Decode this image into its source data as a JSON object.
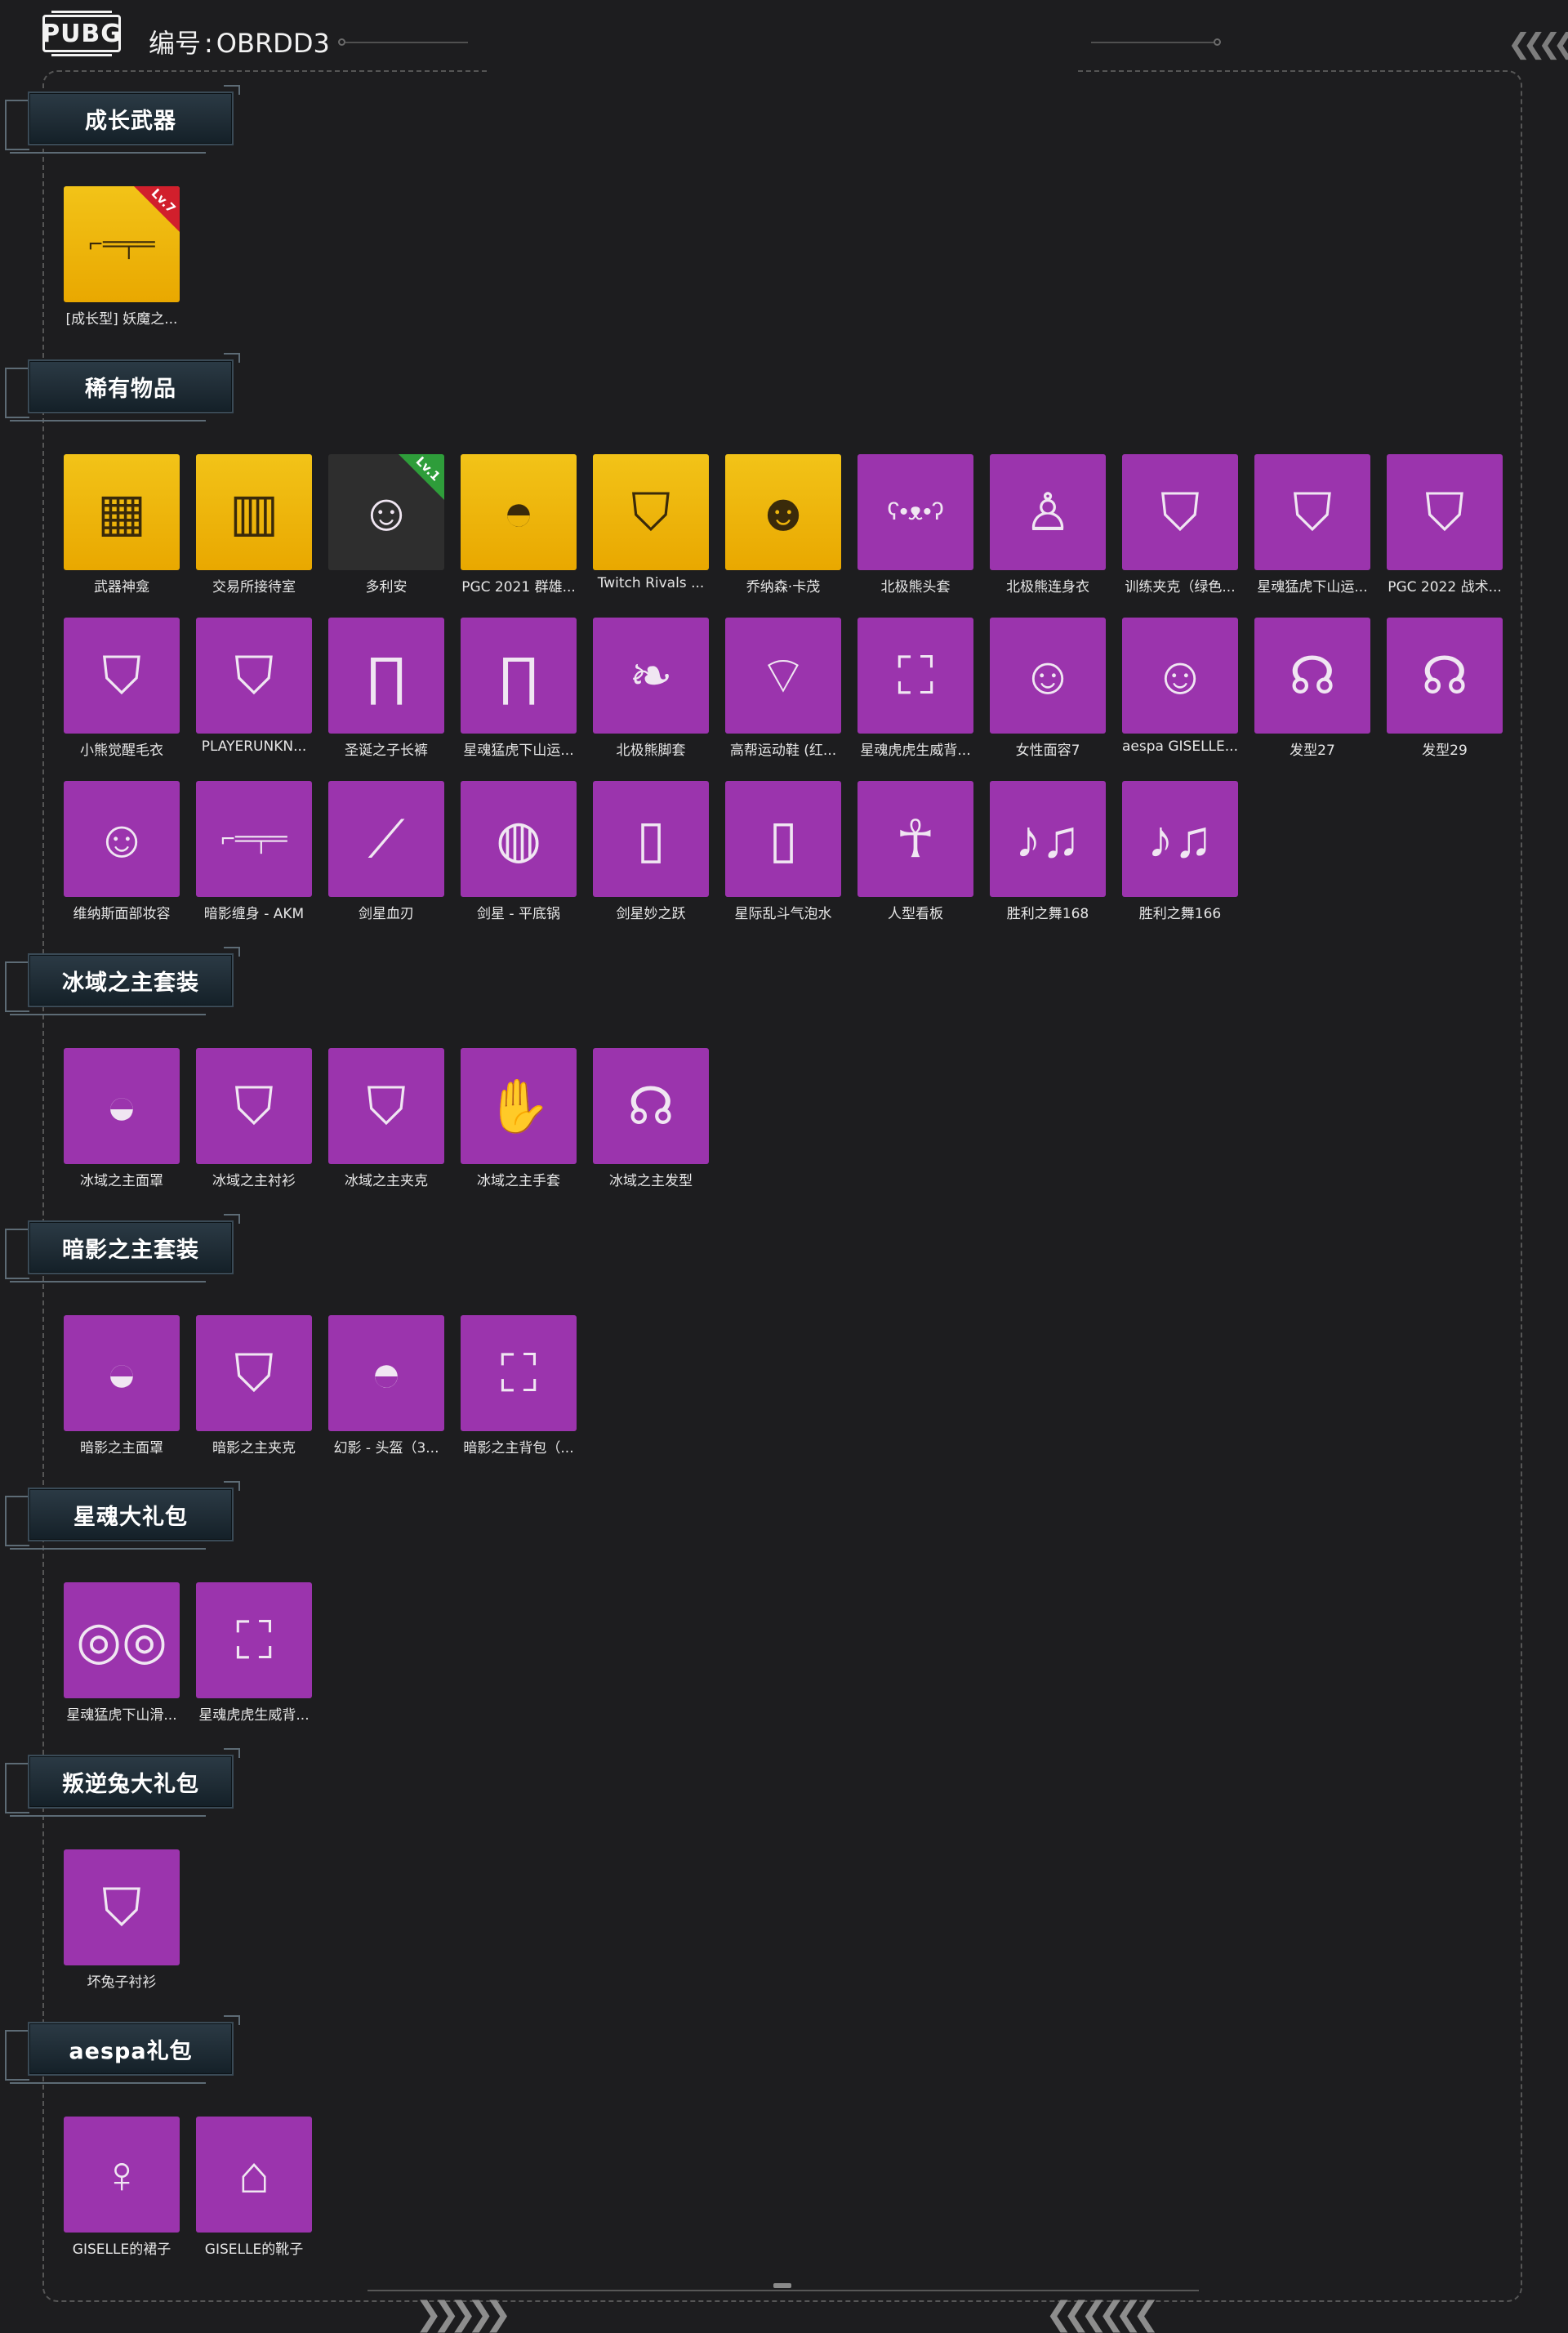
{
  "header": {
    "logo": "PUBG",
    "account_label": "编号",
    "account_sep": ":",
    "account_id": "OBRDD3"
  },
  "sections": [
    {
      "title": "成长武器",
      "items": [
        {
          "label": "[成长型] 妖魔之...",
          "bg": "gold",
          "icon": "rifle-icon",
          "badge": "Lv.7",
          "badge_color": "red"
        }
      ]
    },
    {
      "title": "稀有物品",
      "items": [
        {
          "label": "武器神龛",
          "bg": "gold",
          "icon": "shrine-room-icon"
        },
        {
          "label": "交易所接待室",
          "bg": "gold",
          "icon": "lobby-room-icon"
        },
        {
          "label": "多利安",
          "bg": "photo",
          "icon": "character-portrait-icon",
          "badge": "Lv.1",
          "badge_color": "green"
        },
        {
          "label": "PGC 2021 群雄...",
          "bg": "gold",
          "icon": "mask-icon"
        },
        {
          "label": "Twitch Rivals ...",
          "bg": "gold",
          "icon": "jacket-icon"
        },
        {
          "label": "乔纳森·卡茂",
          "bg": "gold",
          "icon": "character-head-icon"
        },
        {
          "label": "北极熊头套",
          "bg": "purple",
          "icon": "bear-head-icon"
        },
        {
          "label": "北极熊连身衣",
          "bg": "purple",
          "icon": "jumpsuit-icon"
        },
        {
          "label": "训练夹克（绿色...",
          "bg": "purple",
          "icon": "jacket-icon"
        },
        {
          "label": "星魂猛虎下山运...",
          "bg": "purple",
          "icon": "jacket-icon"
        },
        {
          "label": "PGC 2022 战术...",
          "bg": "purple",
          "icon": "vest-icon"
        },
        {
          "label": "小熊觉醒毛衣",
          "bg": "purple",
          "icon": "sweater-icon"
        },
        {
          "label": "PLAYERUNKN...",
          "bg": "purple",
          "icon": "coat-icon"
        },
        {
          "label": "圣诞之子长裤",
          "bg": "purple",
          "icon": "pants-icon"
        },
        {
          "label": "星魂猛虎下山运...",
          "bg": "purple",
          "icon": "pants-icon"
        },
        {
          "label": "北极熊脚套",
          "bg": "purple",
          "icon": "paw-shoes-icon"
        },
        {
          "label": "高帮运动鞋 (红...",
          "bg": "purple",
          "icon": "sneakers-icon"
        },
        {
          "label": "星魂虎虎生威背...",
          "bg": "purple",
          "icon": "tiger-backpack-icon"
        },
        {
          "label": "女性面容7",
          "bg": "purple",
          "icon": "female-face-icon"
        },
        {
          "label": "aespa GISELLE...",
          "bg": "purple",
          "icon": "female-face-icon"
        },
        {
          "label": "发型27",
          "bg": "purple",
          "icon": "hairstyle-icon"
        },
        {
          "label": "发型29",
          "bg": "purple",
          "icon": "hairstyle-icon"
        },
        {
          "label": "维纳斯面部妆容",
          "bg": "purple",
          "icon": "female-face-icon"
        },
        {
          "label": "暗影缠身 - AKM",
          "bg": "purple",
          "icon": "rifle-icon"
        },
        {
          "label": "剑星血刃",
          "bg": "purple",
          "icon": "blade-icon"
        },
        {
          "label": "剑星 - 平底锅",
          "bg": "purple",
          "icon": "pan-icon"
        },
        {
          "label": "剑星妙之跃",
          "bg": "purple",
          "icon": "soda-can-icon"
        },
        {
          "label": "星际乱斗气泡水",
          "bg": "purple",
          "icon": "soda-can-icon"
        },
        {
          "label": "人型看板",
          "bg": "purple",
          "icon": "figure-sign-icon"
        },
        {
          "label": "胜利之舞168",
          "bg": "purple",
          "icon": "dance-emote-icon"
        },
        {
          "label": "胜利之舞166",
          "bg": "purple",
          "icon": "dance-emote-icon"
        }
      ]
    },
    {
      "title": "冰域之主套装",
      "items": [
        {
          "label": "冰域之主面罩",
          "bg": "purple",
          "icon": "face-mask-icon"
        },
        {
          "label": "冰域之主衬衫",
          "bg": "purple",
          "icon": "shirt-icon"
        },
        {
          "label": "冰域之主夹克",
          "bg": "purple",
          "icon": "coat-icon"
        },
        {
          "label": "冰域之主手套",
          "bg": "purple",
          "icon": "gloves-icon"
        },
        {
          "label": "冰域之主发型",
          "bg": "purple",
          "icon": "hairstyle-icon"
        }
      ]
    },
    {
      "title": "暗影之主套装",
      "items": [
        {
          "label": "暗影之主面罩",
          "bg": "purple",
          "icon": "face-mask-icon"
        },
        {
          "label": "暗影之主夹克",
          "bg": "purple",
          "icon": "coat-icon"
        },
        {
          "label": "幻影 - 头盔（3...",
          "bg": "purple",
          "icon": "helmet-icon"
        },
        {
          "label": "暗影之主背包（...",
          "bg": "purple",
          "icon": "backpack-icon"
        }
      ]
    },
    {
      "title": "星魂大礼包",
      "items": [
        {
          "label": "星魂猛虎下山滑...",
          "bg": "purple",
          "icon": "goggles-icon"
        },
        {
          "label": "星魂虎虎生威背...",
          "bg": "purple",
          "icon": "tiger-backpack-icon"
        }
      ]
    },
    {
      "title": "叛逆兔大礼包",
      "items": [
        {
          "label": "坏兔子衬衫",
          "bg": "purple",
          "icon": "shirt-icon"
        }
      ]
    },
    {
      "title": "aespa礼包",
      "items": [
        {
          "label": "GISELLE的裙子",
          "bg": "purple",
          "icon": "dress-icon"
        },
        {
          "label": "GISELLE的靴子",
          "bg": "purple",
          "icon": "boots-icon"
        }
      ]
    }
  ],
  "colors": {
    "background": "#1d1d1f",
    "tile_purple": "#9b34ad",
    "tile_gold": "#f2c318",
    "badge_red": "#d11f2c",
    "badge_green": "#2e9d3a"
  }
}
